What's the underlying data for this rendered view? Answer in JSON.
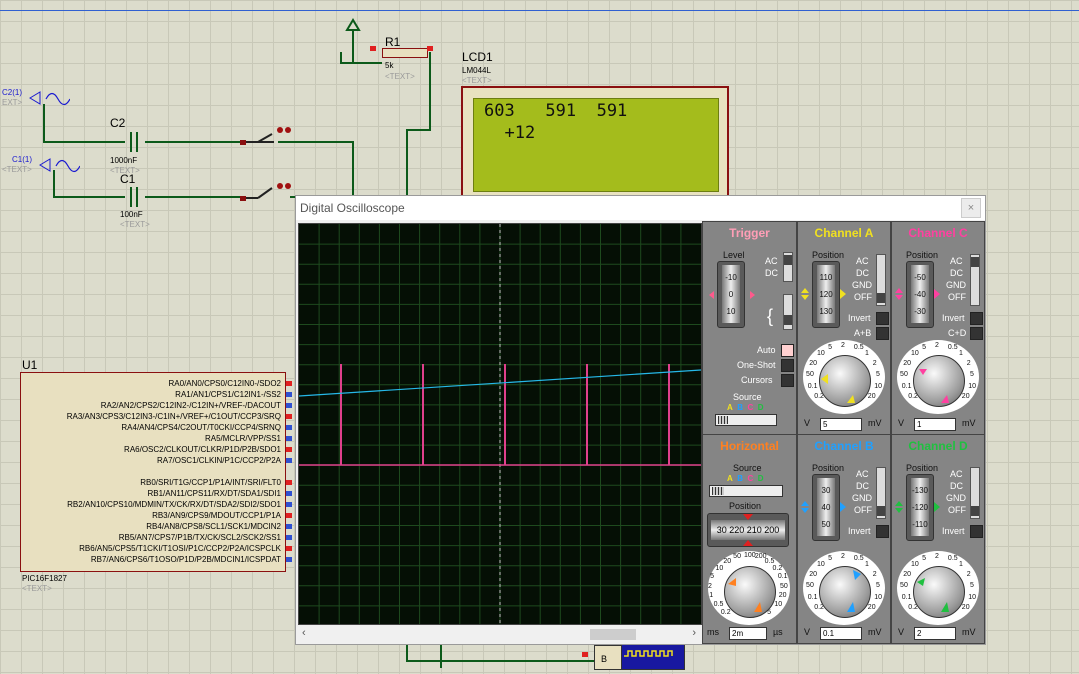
{
  "schematic": {
    "r1": {
      "name": "R1",
      "value": "5k",
      "text": "<TEXT>"
    },
    "lcd": {
      "name": "LCD1",
      "model": "LM044L",
      "text": "<TEXT>",
      "line1": "603   591  591",
      "line2": "  +12"
    },
    "c2": {
      "name": "C2",
      "value": "1000nF",
      "text": "<TEXT>"
    },
    "c1": {
      "name": "C1",
      "value": "100nF",
      "text": "<TEXT>"
    },
    "gen_c2": {
      "label": "C2(1)",
      "text": "EXT>"
    },
    "gen_c1": {
      "label": "C1(1)",
      "text": "<TEXT>"
    },
    "u1": {
      "name": "U1",
      "model": "PIC16F1827",
      "text": "<TEXT>",
      "pins": [
        "RA0/AN0/CPS0/C12IN0-/SDO2",
        "RA1/AN1/CPS1/C12IN1-/SS2",
        "RA2/AN2/CPS2/C12IN2-/C12IN+/VREF-/DACOUT",
        "RA3/AN3/CPS3/C12IN3-/C1IN+/VREF+/C1OUT/CCP3/SRQ",
        "RA4/AN4/CPS4/C2OUT/T0CKI/CCP4/SRNQ",
        "RA5/MCLR/VPP/SS1",
        "RA6/OSC2/CLKOUT/CLKR/P1D/P2B/SDO1",
        "RA7/OSC1/CLKIN/P1C/CCP2/P2A",
        "",
        "RB0/SRI/T1G/CCP1/P1A/INT/SRI/FLT0",
        "RB1/AN11/CPS11/RX/DT/SDA1/SDI1",
        "RB2/AN10/CPS10/MDMIN/TX/CK/RX/DT/SDA2/SDI2/SDO1",
        "RB3/AN9/CPS9/MDOUT/CCP1/P1A",
        "RB4/AN8/CPS8/SCL1/SCK1/MDCIN2",
        "RB5/AN7/CPS7/P1B/TX/CK/SCL2/SCK2/SS1",
        "RB6/AN5/CPS5/T1CKI/T1OSI/P1C/CCP2/P2A/ICSPCLK",
        "RB7/AN6/CPS6/T1OSO/P1D/P2B/MDCIN1/ICSPDAT"
      ]
    }
  },
  "oscilloscope": {
    "title": "Digital Oscilloscope",
    "close": "×",
    "trigger": {
      "title": "Trigger",
      "level_label": "Level",
      "drum": [
        "-10",
        "0",
        "10"
      ],
      "ac": "AC",
      "dc": "DC",
      "auto": "Auto",
      "oneshot": "One-Shot",
      "cursors": "Cursors",
      "source": "Source",
      "sources": [
        "A",
        "B",
        "C",
        "D"
      ]
    },
    "channel_a": {
      "title": "Channel A",
      "position_label": "Position",
      "drum": [
        "110",
        "120",
        "130"
      ],
      "ac": "AC",
      "dc": "DC",
      "gnd": "GND",
      "off": "OFF",
      "invert": "Invert",
      "aplusb": "A+B",
      "v": "V",
      "value": "5",
      "unit": "mV"
    },
    "channel_c": {
      "title": "Channel C",
      "position_label": "Position",
      "drum": [
        "-50",
        "-40",
        "-30"
      ],
      "ac": "AC",
      "dc": "DC",
      "gnd": "GND",
      "off": "OFF",
      "invert": "Invert",
      "cplusd": "C+D",
      "v": "V",
      "value": "1",
      "unit": "mV"
    },
    "horizontal": {
      "title": "Horizontal",
      "source": "Source",
      "sources": [
        "A",
        "B",
        "C",
        "D"
      ],
      "position_label": "Position",
      "drum": "30 220 210 200",
      "ms": "ms",
      "value": "2m",
      "unit": "µs"
    },
    "channel_b": {
      "title": "Channel B",
      "position_label": "Position",
      "drum": [
        "30",
        "40",
        "50"
      ],
      "ac": "AC",
      "dc": "DC",
      "gnd": "GND",
      "off": "OFF",
      "invert": "Invert",
      "v": "V",
      "value": "0.1",
      "unit": "mV"
    },
    "channel_d": {
      "title": "Channel D",
      "position_label": "Position",
      "drum": [
        "-130",
        "-120",
        "-110"
      ],
      "ac": "AC",
      "dc": "DC",
      "gnd": "GND",
      "off": "OFF",
      "invert": "Invert",
      "v": "V",
      "value": "2",
      "unit": "mV"
    },
    "dial_v": [
      "0.2",
      "0.1",
      "50",
      "20",
      "10",
      "5",
      "2",
      "0.5",
      "1",
      "2",
      "5",
      "10",
      "20"
    ],
    "dial_t": [
      "0.2",
      "0.5",
      "1",
      "2",
      "5",
      "10",
      "20",
      "50",
      "100",
      "200",
      "0.5",
      "0.2",
      "0.1",
      "50",
      "20",
      "10",
      "5"
    ],
    "colors": {
      "trace_a": "#26b8e8",
      "trace_c": "#e0408c",
      "trigger": "#ff8aa8",
      "channel_a": "#f0e020",
      "channel_c": "#ff40a0",
      "horizontal": "#ff8020",
      "channel_b": "#20a0ff",
      "channel_d": "#20c040"
    }
  },
  "taskbar": {
    "b": "B"
  }
}
